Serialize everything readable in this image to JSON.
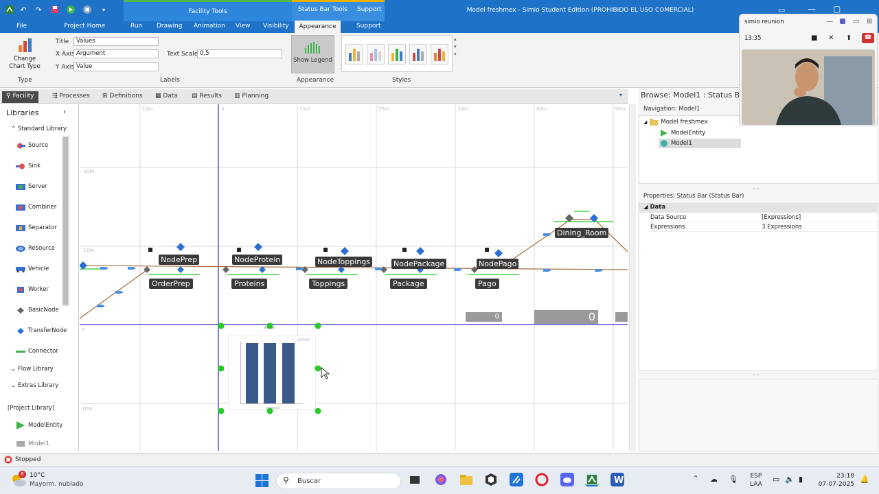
{
  "titlebar": {
    "window_title": "Model freshmex - Simio Student Edition (PROHIBIDO EL USO COMERCIAL)",
    "ctx_facility": "Facility Tools",
    "ctx_statusbar": "Status Bar Tools",
    "ctx_support": "Support",
    "menu": [
      "File",
      "Project Home",
      "Run",
      "Drawing",
      "Animation",
      "View",
      "Visibility",
      "Appearance",
      "Support"
    ]
  },
  "ribbon": {
    "change_chart_type": "Change Chart Type",
    "type_group": "Type",
    "title_label": "Title",
    "title_value": "Values",
    "xaxis_label": "X Axis",
    "xaxis_value": "Argument",
    "yaxis_label": "Y Axis",
    "yaxis_value": "Value",
    "text_scale_label": "Text Scale",
    "text_scale_value": "0,5",
    "labels_group": "Labels",
    "show_legend": "Show Legend",
    "appearance_group": "Appearance",
    "styles_group": "Styles"
  },
  "tabs": [
    "Facility",
    "Processes",
    "Definitions",
    "Data",
    "Results",
    "Planning"
  ],
  "libraries": {
    "header": "Libraries",
    "standard": "Standard Library",
    "items": [
      "Source",
      "Sink",
      "Server",
      "Combiner",
      "Separator",
      "Resource",
      "Vehicle",
      "Worker",
      "BasicNode",
      "TransferNode",
      "Connector"
    ],
    "flow": "Flow Library",
    "extras": "Extras Library",
    "project": "[Project Library]",
    "project_items": [
      "ModelEntity",
      "Model1"
    ]
  },
  "canvas": {
    "ruler_top": [
      "10m",
      "0",
      "10m",
      "20m",
      "30m",
      "40m",
      "50m"
    ],
    "ruler_left": [
      "-20m",
      "-10m",
      "0",
      "10m"
    ],
    "nodes": [
      "NodePrep",
      "NodeProtein",
      "NodeToppings",
      "NodePackage",
      "NodePago",
      "Dining_Room"
    ],
    "servers": [
      "OrderPrep",
      "Proteins",
      "Toppings",
      "Package",
      "Pago"
    ],
    "status_values": [
      "0",
      "0"
    ],
    "chart_title": "Values",
    "chart_xlabel": "Argument"
  },
  "browse": {
    "title": "Browse: Model1 : Status Bar",
    "nav_header": "Navigation: Model1",
    "tree": [
      "Model freshmex",
      "ModelEntity",
      "Model1"
    ]
  },
  "properties": {
    "header": "Properties: Status Bar (Status Bar)",
    "section": "Data",
    "rows": [
      {
        "name": "Data Source",
        "value": "[Expressions]"
      },
      {
        "name": "Expressions",
        "value": "3 Expressions"
      }
    ]
  },
  "status": {
    "text": "Stopped"
  },
  "video": {
    "title": "simio reunion",
    "time": "13:35"
  },
  "taskbar": {
    "weather_temp": "10°C",
    "weather_desc": "Mayorm. nublado",
    "weather_badge": "6",
    "search_placeholder": "Buscar",
    "lang1": "ESP",
    "lang2": "LAA",
    "time": "23:18",
    "date": "07-07-2025"
  },
  "colors": {
    "accent": "#1e73c9",
    "node_blue": "#2a6fd1",
    "grid": "#d8d8d8",
    "selection": "#5050c8",
    "handle": "#22cc22"
  }
}
